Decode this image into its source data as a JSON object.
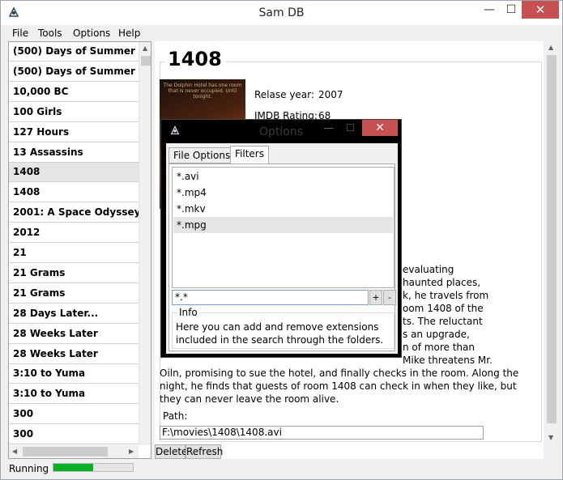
{
  "window": {
    "title": "Sam DB",
    "min_glyph": "—",
    "max_glyph": "☐",
    "close_glyph": "✕",
    "icon": "app-icon"
  },
  "menu": [
    "File",
    "Tools",
    "Options",
    "Help"
  ],
  "movie_list": [
    "(500) Days of Summer",
    "(500) Days of Summer",
    "10,000 BC",
    "100 Girls",
    "127 Hours",
    "13 Assassins",
    "1408",
    "1408",
    "2001: A Space Odyssey",
    "2012",
    "21",
    "21 Grams",
    "21 Grams",
    "28 Days Later...",
    "28 Weeks Later",
    "28 Weeks Later",
    "3:10 to Yuma",
    "3:10 to Yuma",
    "300",
    "300"
  ],
  "selected_index": 6,
  "detail": {
    "title": "1408",
    "poster_text": "The Dolphin Hotel has one room that is never occupied. Until tonight.",
    "release_label": "Relase year:",
    "release_value": "2007",
    "rating_label": "IMDB Rating:",
    "rating_value": "68",
    "plot_fragments_right": [
      "evaluating",
      "haunted places,",
      "k, he travels from",
      "oom 1408 of the",
      "ts. The reluctant",
      "s an upgrade,",
      "n of more than",
      "Mike threatens Mr."
    ],
    "plot_line_1": "Oiln, promising to sue the hotel, and finally checks in the room. Along the",
    "plot_line_2": "night, he finds that guests of room 1408 can check in when they like, but",
    "plot_line_3": "they can never leave the room alive.",
    "path_label": "Path:",
    "path_value": "F:\\movies\\1408\\1408.avi"
  },
  "buttons": {
    "delete": "Delete",
    "refresh": "Refresh"
  },
  "status": {
    "text": "Running",
    "progress": 0.5
  },
  "options_dialog": {
    "title": "Options",
    "min_glyph": "—",
    "max_glyph": "☐",
    "close_glyph": "✕",
    "tabs": [
      "File Options",
      "Filters"
    ],
    "active_tab": "Filters",
    "extensions": [
      "*.avi",
      "*.mp4",
      "*.mkv",
      "*.mpg"
    ],
    "selected_extension": 3,
    "input_value": "*.*",
    "add_label": "+",
    "remove_label": "-",
    "info_label": "Info",
    "info_text": "Here you can add and remove extensions included in the search through the folders."
  },
  "colors": {
    "progress": "#06b025",
    "close_button": "#c75050"
  }
}
